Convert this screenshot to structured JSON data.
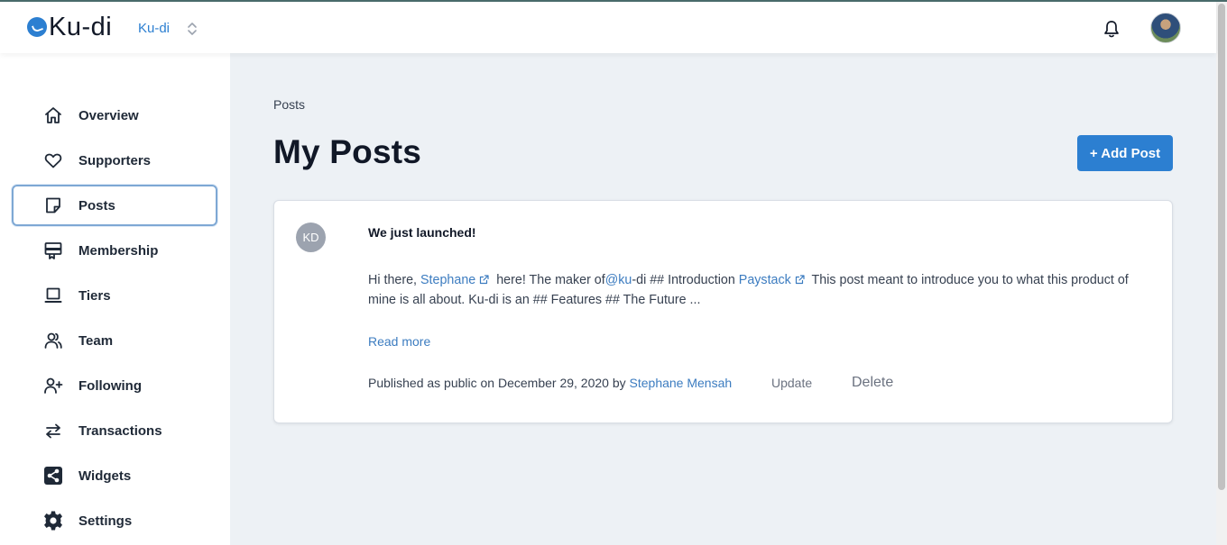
{
  "header": {
    "logo_text": "Ku-di",
    "workspace_name": "Ku-di",
    "notifications_icon": "bell-icon",
    "avatar_icon": "user-avatar"
  },
  "sidebar": {
    "items": [
      {
        "label": "Overview",
        "icon": "home-icon",
        "active": false
      },
      {
        "label": "Supporters",
        "icon": "heart-icon",
        "active": false
      },
      {
        "label": "Posts",
        "icon": "note-icon",
        "active": true
      },
      {
        "label": "Membership",
        "icon": "membership-card-icon",
        "active": false
      },
      {
        "label": "Tiers",
        "icon": "laptop-icon",
        "active": false
      },
      {
        "label": "Team",
        "icon": "users-icon",
        "active": false
      },
      {
        "label": "Following",
        "icon": "user-plus-icon",
        "active": false
      },
      {
        "label": "Transactions",
        "icon": "arrows-swap-icon",
        "active": false
      },
      {
        "label": "Widgets",
        "icon": "share-icon",
        "active": false
      },
      {
        "label": "Settings",
        "icon": "gear-icon",
        "active": false
      }
    ]
  },
  "main": {
    "breadcrumb": "Posts",
    "title": "My Posts",
    "add_button_label": "+ Add Post",
    "post": {
      "avatar_initials": "KD",
      "title": "We just launched!",
      "excerpt": {
        "p1": "Hi there, ",
        "link1": "Stephane",
        "p2": " here! The maker of",
        "link2": "@ku",
        "p3": "-di ## Introduction ",
        "link3": "Paystack",
        "p4": " This post meant to introduce you to what this product of mine is all about. Ku-di is an ## Features ## The Future ..."
      },
      "read_more": "Read more",
      "meta_text": "Published as public on December 29, 2020 by ",
      "author": "Stephane Mensah",
      "update_label": "Update",
      "delete_label": "Delete"
    }
  },
  "colors": {
    "accent": "#2c7fd1",
    "link": "#3c7cc0",
    "main_bg": "#edf1f5",
    "active_border": "#7ea8d4"
  }
}
